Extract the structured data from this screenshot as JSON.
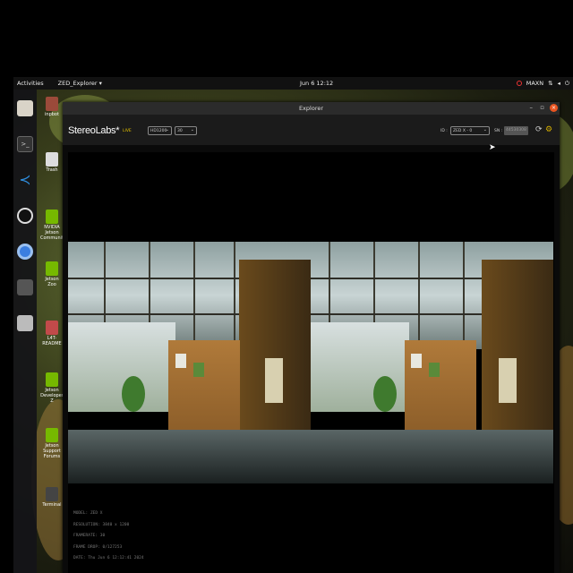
{
  "topbar": {
    "activities": "Activities",
    "app_menu": "ZED_Explorer ▾",
    "clock": "Jun 6  12:12",
    "tray_label": "MAXN"
  },
  "desktop_icons": [
    {
      "label": "inpbot"
    },
    {
      "label": "Trash"
    },
    {
      "label": "NVIDIA Jetson Community"
    },
    {
      "label": "Jetson Zoo"
    },
    {
      "label": "L4T-README"
    },
    {
      "label": "Jetson Developer Z"
    },
    {
      "label": "Jetson Support Forums"
    },
    {
      "label": "Terminal"
    }
  ],
  "window": {
    "title": "Explorer",
    "brand": "StereoLabs*",
    "live_label": "LIVE",
    "resolution_value": "HD1200",
    "fps_value": "30",
    "sn_label_left": "ID :",
    "device_select_value": "ZED X - 0",
    "sn_label": "SN :",
    "sn_value": "44530308"
  },
  "info": {
    "model": "MODEL: ZED X",
    "resolution": "RESOLUTION: 3840 x 1200",
    "framerate": "FRAMERATE: 30",
    "frame_drop": "FRAME DROP: 0/127253",
    "date": "DATE: Thu Jun 6 12:12:41 2024"
  },
  "colors": {
    "accent_orange": "#e95420",
    "live_yellow": "#e8c400"
  }
}
